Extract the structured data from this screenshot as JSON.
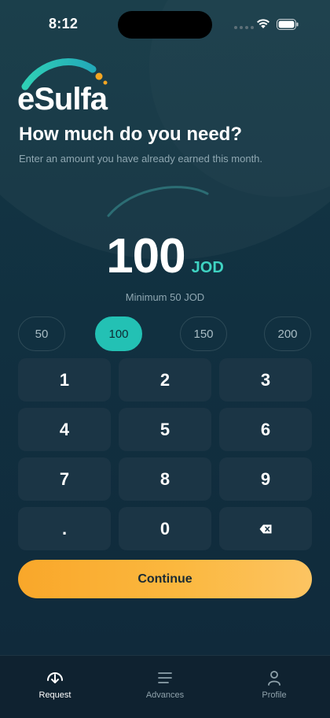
{
  "status_bar": {
    "time": "8:12",
    "icons": [
      "signal-dots-icon",
      "wifi-icon",
      "battery-icon"
    ]
  },
  "brand": {
    "logo_text": "eSulfa",
    "accent_color": "#23c1b4",
    "dot_color": "#f5a623"
  },
  "header": {
    "title": "How much do you need?",
    "subtitle": "Enter an amount you have already earned this month."
  },
  "amount": {
    "value": "100",
    "currency": "JOD",
    "minimum_text": "Minimum 50 JOD"
  },
  "quick_amounts": [
    {
      "label": "50",
      "selected": false
    },
    {
      "label": "100",
      "selected": true
    },
    {
      "label": "150",
      "selected": false
    },
    {
      "label": "200",
      "selected": false
    }
  ],
  "keypad": {
    "keys": [
      "1",
      "2",
      "3",
      "4",
      "5",
      "6",
      "7",
      "8",
      "9",
      ".",
      "0"
    ],
    "backspace_icon": "backspace-icon"
  },
  "actions": {
    "continue_label": "Continue",
    "continue_color": "#f9a72a"
  },
  "tabbar": {
    "tabs": [
      {
        "label": "Request",
        "icon": "download-circle-icon",
        "active": true
      },
      {
        "label": "Advances",
        "icon": "list-icon",
        "active": false
      },
      {
        "label": "Profile",
        "icon": "person-icon",
        "active": false
      }
    ]
  }
}
